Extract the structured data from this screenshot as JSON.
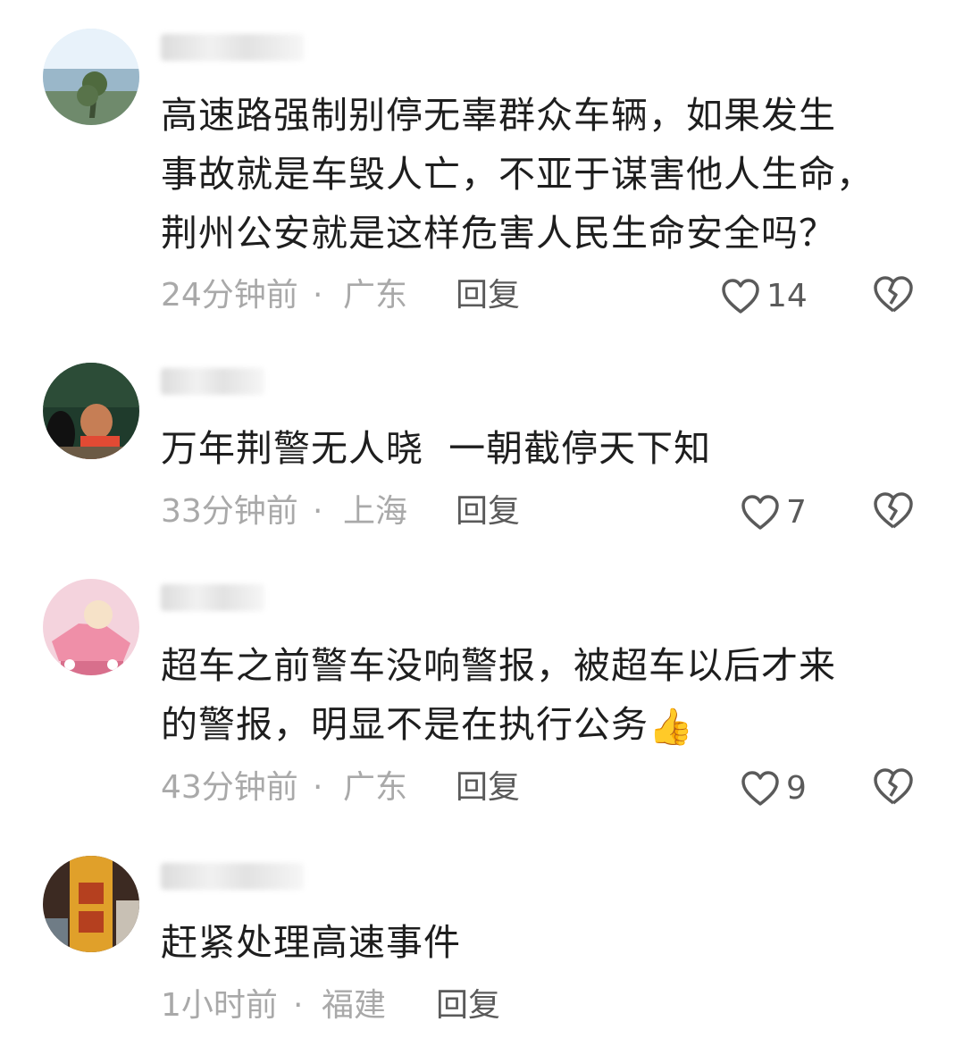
{
  "comments": [
    {
      "text_lines": [
        "高速路强制别停无辜群众车辆，如果发生",
        "事故就是车毁人亡，不亚于谋害他人生命，",
        "荆州公安就是这样危害人民生命安全吗？"
      ],
      "time": "24分钟前",
      "location": "广东",
      "reply": "回复",
      "likes": "14"
    },
    {
      "text_lines": [
        "万年荆警无人晓  一朝截停天下知"
      ],
      "time": "33分钟前",
      "location": "上海",
      "reply": "回复",
      "likes": "7"
    },
    {
      "text_lines": [
        "超车之前警车没响警报，被超车以后才来",
        "的警报，明显不是在执行公务"
      ],
      "emoji": "👍",
      "time": "43分钟前",
      "location": "广东",
      "reply": "回复",
      "likes": "9"
    },
    {
      "text_lines": [
        "赶紧处理高速事件"
      ],
      "time": "1小时前",
      "location": "福建",
      "reply": "回复"
    }
  ],
  "separator": "·",
  "colors": {
    "meta": "#a9a9a9",
    "text": "#1e1e1e",
    "action": "#5a5a5a"
  },
  "icons": {
    "like": "heart-outline-icon",
    "dislike": "broken-heart-icon"
  }
}
